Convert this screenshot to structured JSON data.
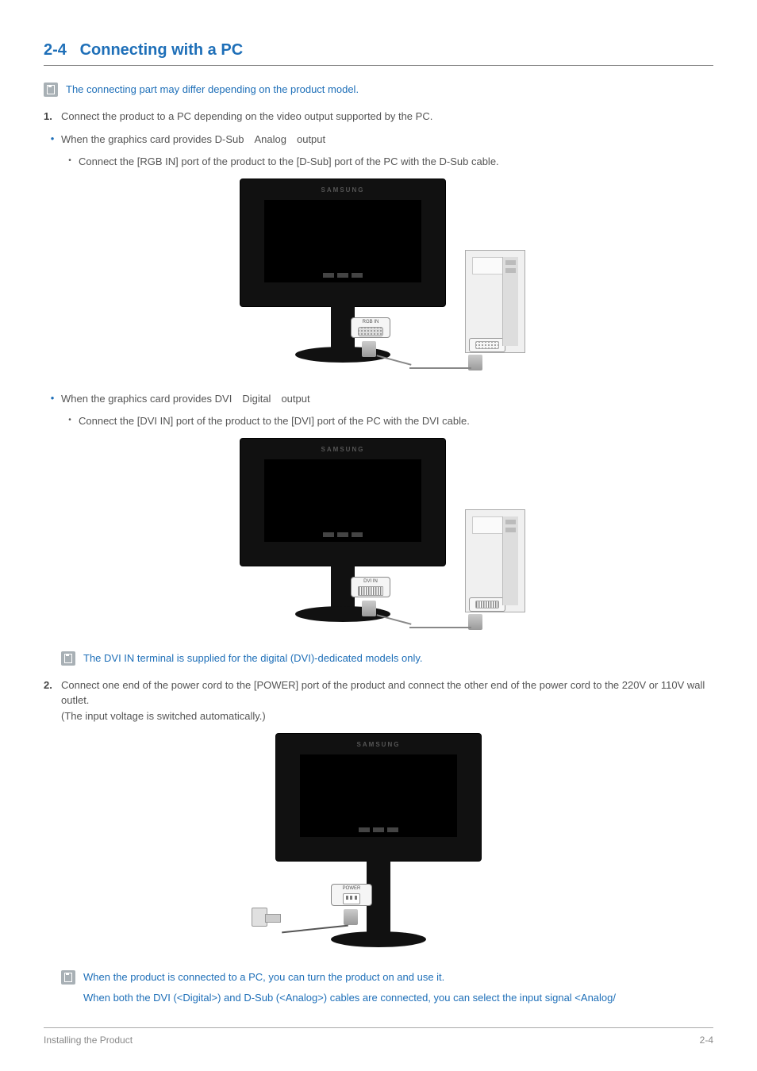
{
  "section": {
    "number": "2-4",
    "title": "Connecting with a PC"
  },
  "note_top": "The connecting part may differ depending on the product model.",
  "step1": {
    "num": "1.",
    "text": "Connect the product to a PC depending on the video output supported by the PC."
  },
  "dsub": {
    "line": "When the graphics card provides D-Sub Analog output",
    "sub": "Connect the [RGB IN] port of the product to the [D-Sub] port of the PC with the D-Sub cable.",
    "port_label": "RGB IN"
  },
  "dvi": {
    "line": "When the graphics card provides DVI Digital output",
    "sub": "Connect the [DVI IN] port of the product to the [DVI] port of the PC with the DVI cable.",
    "port_label": "DVI IN"
  },
  "note_dvi": "The DVI IN terminal is supplied for the digital (DVI)-dedicated models only.",
  "step2": {
    "num": "2.",
    "line1": "Connect one end of the power cord to the [POWER] port of the product and connect the other end of the power cord to the 220V or 110V wall outlet.",
    "line2": "(The input voltage is switched automatically.)",
    "port_label": "POWER"
  },
  "note_bottom": {
    "line1": "When the product is connected to a PC, you can turn the product on and use it.",
    "line2": "When both the DVI (<Digital>) and D-Sub (<Analog>) cables are connected, you can select the input signal <Analog/"
  },
  "footer": {
    "left": "Installing the Product",
    "right": "2-4"
  }
}
